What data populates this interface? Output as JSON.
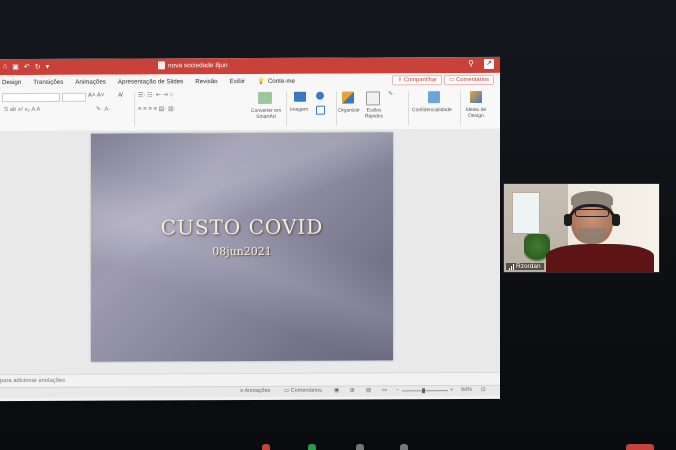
{
  "window": {
    "doc_title": "nova sociedade 8jun",
    "qa_icons": [
      "home-icon",
      "save-icon",
      "undo-icon",
      "redo-icon",
      "more-icon"
    ]
  },
  "tabs": [
    "Design",
    "Transições",
    "Animações",
    "Apresentação de Slides",
    "Revisão",
    "Exibir"
  ],
  "tell_me": "Conte-me",
  "share_label": "Compartilhar",
  "comments_label": "Comentários",
  "ribbon": {
    "convert": "Converter em SmartArt",
    "image": "Imagem",
    "organize": "Organizar",
    "quick_styles": "Estilos Rápidos",
    "confidentiality": "Confidencialidade",
    "design_ideas": "Ideias de Design"
  },
  "slide": {
    "title": "CUSTO COVID",
    "subtitle": "08jun2021"
  },
  "notes_placeholder": "para adicionar anotações",
  "status": {
    "notes": "Anotações",
    "comments": "Comentários",
    "zoom": "94%"
  },
  "video": {
    "participant": "Rzordan"
  },
  "colors": {
    "accent": "#c8423a",
    "slide_text": "#f4ecd8"
  }
}
